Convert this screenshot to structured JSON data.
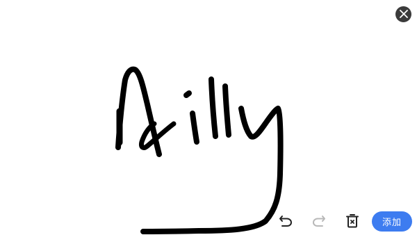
{
  "signature_pad": {
    "icons": {
      "close": "close-icon",
      "undo": "undo-icon",
      "redo": "redo-icon",
      "clear": "trash-icon"
    },
    "colors": {
      "ink": "#000000",
      "close_bg": "#3b3b3b",
      "accent": "#3d7cf0",
      "redo_disabled": "#b8b8b8"
    },
    "add_label": "添加"
  }
}
